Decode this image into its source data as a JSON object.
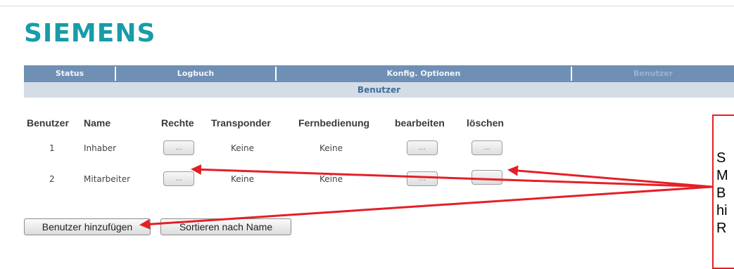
{
  "brand": {
    "logo": "SIEMENS"
  },
  "nav": {
    "items": [
      {
        "label": "Status"
      },
      {
        "label": "Logbuch"
      },
      {
        "label": "Konfig. Optionen"
      },
      {
        "label": "Benutzer",
        "active": true
      }
    ]
  },
  "page": {
    "subtitle": "Benutzer"
  },
  "table": {
    "headers": [
      "Benutzer",
      "Name",
      "Rechte",
      "Transponder",
      "Fernbedienung",
      "bearbeiten",
      "löschen"
    ],
    "rows": [
      {
        "id": "1",
        "name": "Inhaber",
        "rights": "...",
        "transponder": "Keine",
        "remote": "Keine",
        "edit": "...",
        "delete": "..."
      },
      {
        "id": "2",
        "name": "Mitarbeiter",
        "rights": "...",
        "transponder": "Keine",
        "remote": "Keine",
        "edit": "...",
        "delete": "..."
      }
    ]
  },
  "actions": {
    "add_user": "Benutzer hinzufügen",
    "sort_by_name": "Sortieren nach Name"
  },
  "callout": {
    "lines": [
      "S",
      "M",
      "B",
      "hi",
      "R"
    ],
    "border_color": "#e32027"
  },
  "colors": {
    "logo": "#189ca8",
    "nav_bar": "#6f8fb5",
    "sub_bar": "#d4dce6",
    "annotation": "#e32027"
  }
}
